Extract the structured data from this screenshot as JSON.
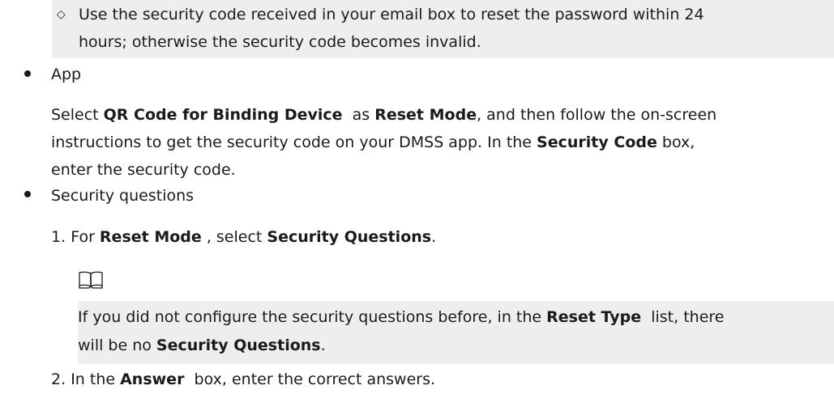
{
  "email_note": {
    "symbol": "◇",
    "line1": "Use the security code received in your email box to reset the password within 24",
    "line2": "hours; otherwise the security code becomes invalid."
  },
  "app_item": {
    "title": "App",
    "l1_a": "Select ",
    "l1_b": "QR Code for Binding Device",
    "l1_c": "  as ",
    "l1_d": "Reset Mode",
    "l1_e": ", and then follow the on-screen",
    "l2_a": "instructions to get the security code on your DMSS app. In the ",
    "l2_b": "Security Code",
    "l2_c": " box,",
    "l3": "enter the security code."
  },
  "security_item": {
    "title": "Security questions",
    "step1_num": "1.",
    "step1_a": "For ",
    "step1_b": "Reset Mode",
    "step1_c": " , select ",
    "step1_d": "Security Questions",
    "step1_e": ".",
    "note_icon": "book-note-icon",
    "note_l1_a": "If you did not configure the security questions before, in the ",
    "note_l1_b": "Reset Type",
    "note_l1_c": "  list, there",
    "note_l2_a": "will be no ",
    "note_l2_b": "Security Questions",
    "note_l2_c": ".",
    "step2_num": "2.",
    "step2_a": "In the ",
    "step2_b": "Answer",
    "step2_c": "  box, enter the correct answers."
  },
  "colors": {
    "shade": "#eeeeee",
    "text": "#1a1a1a"
  }
}
